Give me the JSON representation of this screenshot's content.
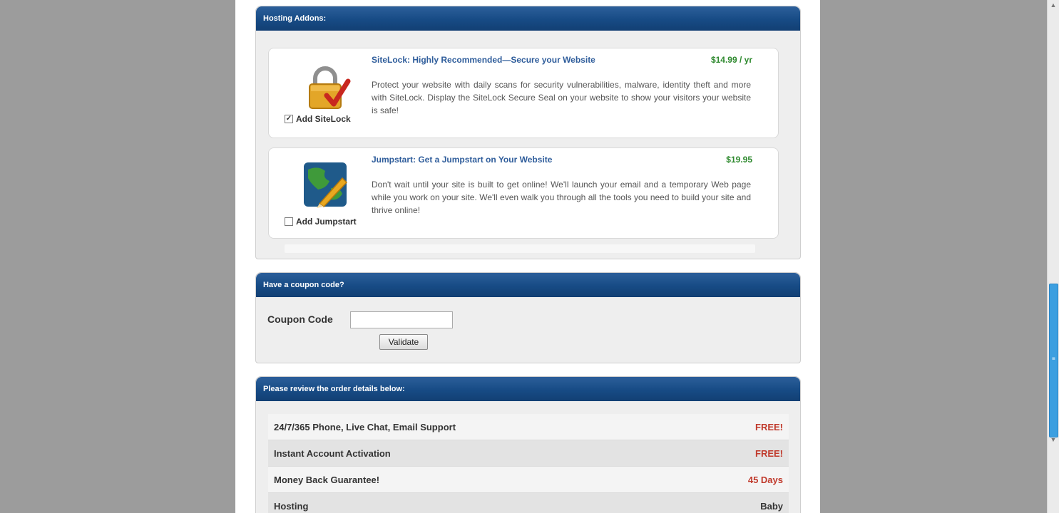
{
  "addons": {
    "header": "Hosting Addons:",
    "items": [
      {
        "title": "SiteLock: Highly Recommended—Secure your Website",
        "price": "$14.99 / yr",
        "description": "Protect your website with daily scans for security vulnerabilities, malware, identity theft and more with SiteLock. Display the SiteLock Secure Seal on your website to show your visitors your website is safe!",
        "checkbox_label": "Add SiteLock",
        "checked": true,
        "icon": "padlock-checkmark-icon"
      },
      {
        "title": "Jumpstart: Get a Jumpstart on Your Website",
        "price": "$19.95",
        "description": "Don't wait until your site is built to get online! We'll launch your email and a temporary Web page while you work on your site. We'll even walk you through all the tools you need to build your site and thrive online!",
        "checkbox_label": "Add Jumpstart",
        "checked": false,
        "icon": "globe-pencil-icon"
      }
    ]
  },
  "coupon": {
    "header": "Have a coupon code?",
    "label": "Coupon Code",
    "input_value": "",
    "validate_label": "Validate"
  },
  "order": {
    "header": "Please review the order details below:",
    "rows": [
      {
        "label": "24/7/365 Phone, Live Chat, Email Support",
        "value": "FREE!"
      },
      {
        "label": "Instant Account Activation",
        "value": "FREE!"
      },
      {
        "label": "Money Back Guarantee!",
        "value": "45 Days"
      },
      {
        "label": "Hosting",
        "value": "Baby"
      }
    ]
  },
  "colors": {
    "header_blue": "#174b85",
    "price_green": "#2f8a2f",
    "title_blue": "#2f5d9b",
    "free_red": "#c0392b",
    "scroll_thumb": "#3c9fe0"
  }
}
